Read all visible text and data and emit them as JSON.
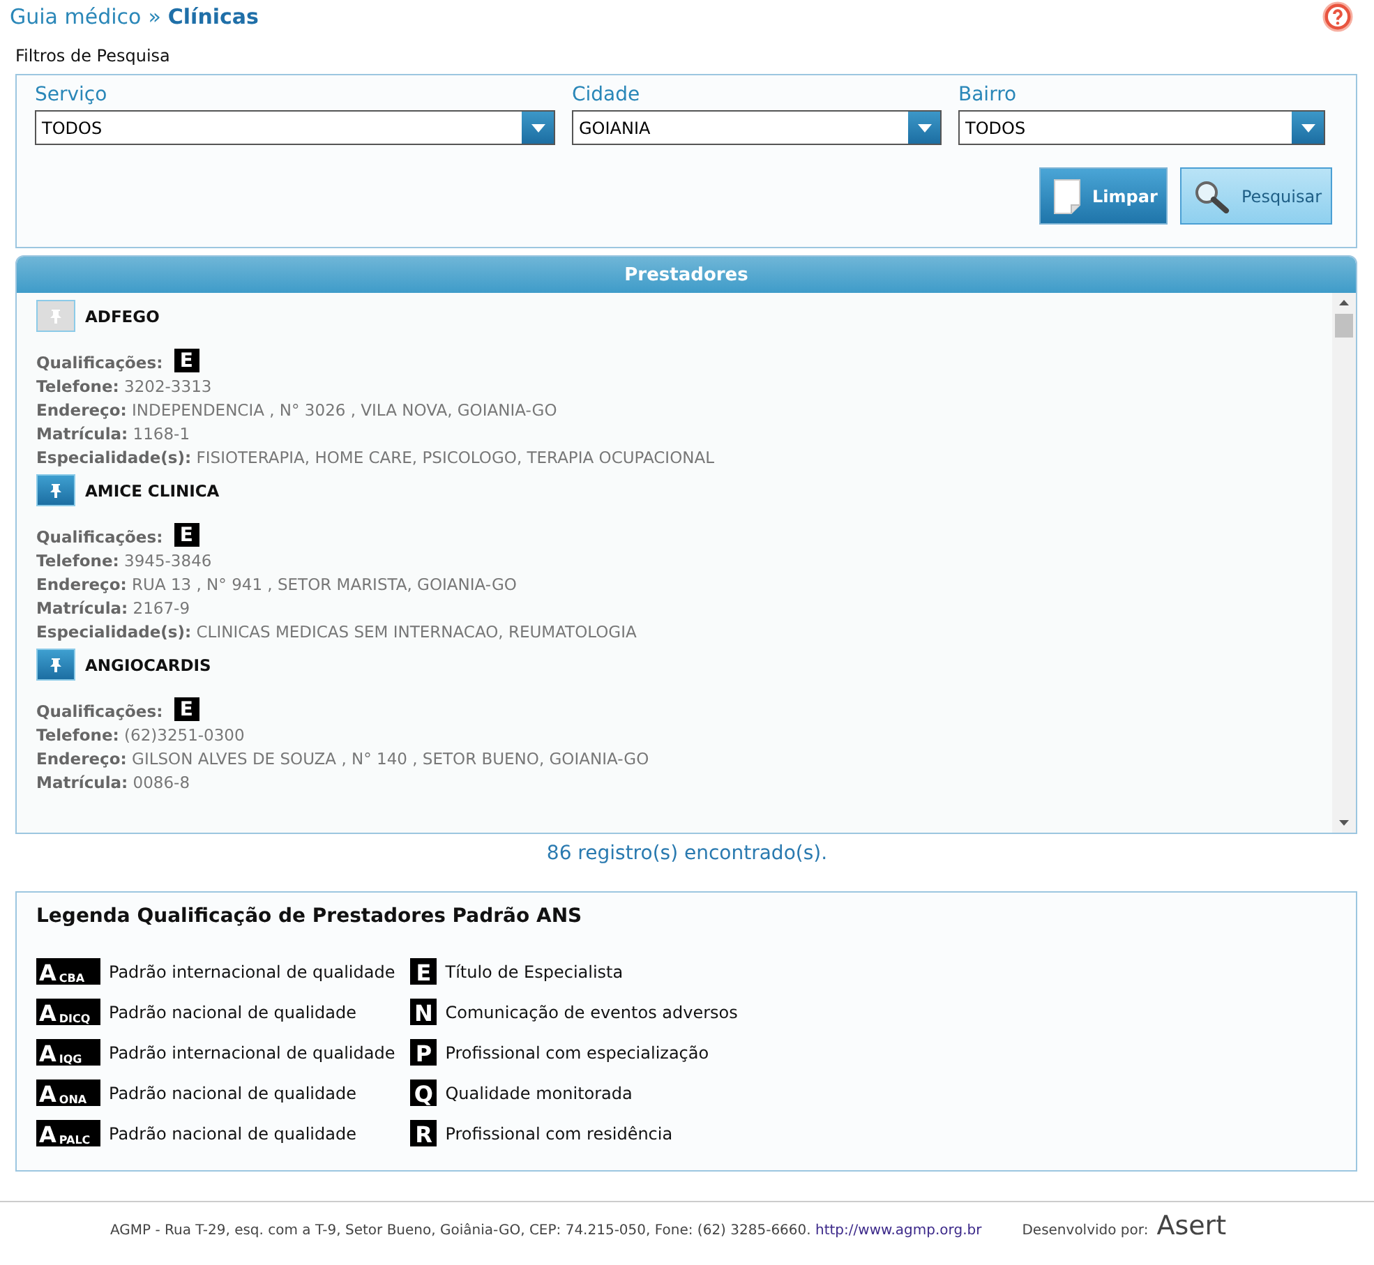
{
  "breadcrumb": {
    "parent": "Guia médico",
    "separator": "»",
    "current": "Clínicas"
  },
  "filters": {
    "title": "Filtros de Pesquisa",
    "fields": [
      {
        "label": "Serviço",
        "value": "TODOS"
      },
      {
        "label": "Cidade",
        "value": "GOIANIA"
      },
      {
        "label": "Bairro",
        "value": "TODOS"
      }
    ],
    "buttons": [
      {
        "label": "Limpar",
        "kind": "clear"
      },
      {
        "label": "Pesquisar",
        "kind": "search"
      }
    ]
  },
  "providers": {
    "title": "Prestadores",
    "items": [
      {
        "name": "ADFEGO",
        "active": false,
        "qualifications": [
          "E"
        ],
        "fields": [
          {
            "label": "Qualificações:"
          },
          {
            "label": "Telefone:",
            "value": "3202-3313"
          },
          {
            "label": "Endereço:",
            "value": "INDEPENDENCIA , N° 3026 , VILA NOVA, GOIANIA-GO"
          },
          {
            "label": "Matrícula:",
            "value": "1168-1"
          },
          {
            "label": "Especialidade(s):",
            "value": "FISIOTERAPIA, HOME CARE, PSICOLOGO, TERAPIA OCUPACIONAL"
          }
        ]
      },
      {
        "name": "AMICE CLINICA",
        "active": true,
        "qualifications": [
          "E"
        ],
        "fields": [
          {
            "label": "Qualificações:"
          },
          {
            "label": "Telefone:",
            "value": "3945-3846"
          },
          {
            "label": "Endereço:",
            "value": "RUA 13 , N° 941 , SETOR MARISTA, GOIANIA-GO"
          },
          {
            "label": "Matrícula:",
            "value": "2167-9"
          },
          {
            "label": "Especialidade(s):",
            "value": "CLINICAS MEDICAS SEM INTERNACAO, REUMATOLOGIA"
          }
        ]
      },
      {
        "name": "ANGIOCARDIS",
        "active": true,
        "qualifications": [
          "E"
        ],
        "fields": [
          {
            "label": "Qualificações:"
          },
          {
            "label": "Telefone:",
            "value": "(62)3251-0300"
          },
          {
            "label": "Endereço:",
            "value": "GILSON ALVES DE SOUZA , N° 140 , SETOR BUENO, GOIANIA-GO"
          },
          {
            "label": "Matrícula:",
            "value": "0086-8"
          }
        ]
      }
    ],
    "count": "86 registro(s) encontrado(s)."
  },
  "legend": {
    "title": "Legenda Qualificação de Prestadores Padrão ANS",
    "columns": [
      [
        {
          "letter": "A",
          "sub": "CBA",
          "text": "Padrão internacional de qualidade"
        },
        {
          "letter": "A",
          "sub": "DICQ",
          "text": "Padrão nacional de qualidade"
        },
        {
          "letter": "A",
          "sub": "IQG",
          "text": "Padrão internacional de qualidade"
        },
        {
          "letter": "A",
          "sub": "ONA",
          "text": "Padrão nacional de qualidade"
        },
        {
          "letter": "A",
          "sub": "PALC",
          "text": "Padrão nacional de qualidade"
        }
      ],
      [
        {
          "letter": "E",
          "text": "Título de Especialista"
        },
        {
          "letter": "N",
          "text": "Comunicação de eventos adversos"
        },
        {
          "letter": "P",
          "text": "Profissional com especialização"
        },
        {
          "letter": "Q",
          "text": "Qualidade monitorada"
        },
        {
          "letter": "R",
          "text": "Profissional com residência"
        }
      ]
    ]
  },
  "footer": {
    "address": "AGMP - Rua T-29, esq. com a T-9, Setor Bueno, Goiânia-GO, CEP: 74.215-050, Fone: (62) 3285-6660.",
    "link": "http://www.agmp.org.br",
    "developed_by": "Desenvolvido por:",
    "brand": "Asert"
  }
}
